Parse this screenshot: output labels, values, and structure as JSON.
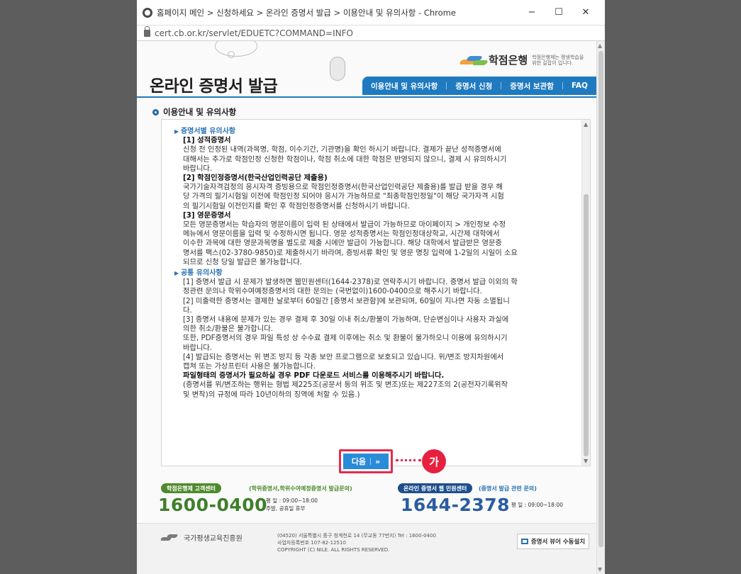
{
  "browser": {
    "title": "홈페이지 메인 > 신청하세요 > 온라인 증명서 발급 > 이용안내 및 유의사항 - Chrome",
    "url": "cert.cb.or.kr/servlet/EDUETC?COMMAND=INFO",
    "minimize": "−",
    "maximize": "☐",
    "close": "✕"
  },
  "header": {
    "bank_name": "학점은행",
    "bank_slogan": "학점은행제는 평생학습을 위한 길잡이 입니다.",
    "site_title": "온라인 증명서 발급",
    "nav": [
      "이용안내 및 유의사항",
      "증명서 신청",
      "증명서 보관함",
      "FAQ"
    ]
  },
  "section_title": "이용안내 및 유의사항",
  "content": {
    "sub1": "증명서별 유의사항",
    "items1": [
      {
        "heading": "[1] 성적증명서",
        "lines": [
          "신청 전 인정된 내역(과목명, 학점, 이수기간, 기관명)을 확인 하시기 바랍니다. 결제가 끝난 성적증명서에",
          "대해서는 추가로 학점인정 신청한 학점이나, 학점 취소에 대한 학점은 반영되지 않으니, 결제 시 유의하시기",
          "바랍니다."
        ]
      },
      {
        "heading": "[2] 학점인정증명서(한국산업인력공단 제출용)",
        "lines": [
          "국가기술자격검정의 응시자격 증빙용으로 학점인정증명서(한국산업인력공단 제출용)를 발급 받을 경우 해",
          "당 가격의 필기시험일 이전에 학점인정 되어야 응시가 가능하므로 \"최종학점인정일\"이 해당 국가자격 시험",
          "의 필기시험일 이전인지를 확인 후 학점인정증명서를 신청하시기 바랍니다."
        ]
      },
      {
        "heading": "[3] 영문증명서",
        "lines": [
          "모든 영문증명서는 학습자의 영문이름이 입력 된 상태에서 발급이 가능하므로 마이페이지 > 개인정보 수정",
          "메뉴에서 영문이름을 입력 및 수정하시면 됩니다. 영문 성적증명서는 학점인정대상학교, 시간제 대학에서",
          "이수한 과목에 대한 영문과목명을 별도로 제출 시에만 발급이 가능합니다. 해당 대학에서 발급받은 영문증",
          "명서를 팩스(02-3780-9850)로 제출하시기 바라며, 증빙서류 확인 및 영문 명칭 입력에 1-2일의 시일이 소요",
          "되므로 신청 당일 발급은 불가능합니다."
        ]
      }
    ],
    "sub2": "공통 유의사항",
    "items2": [
      "[1] 증명서 발급 시 문제가 발생하면 웹민원센터(1644-2378)로 연락주시기 바랍니다. 증명서 발급 이외의 학",
      "정관련 문의나 학위수여예정증명서의 대한 문의는 (국번없이)1600-0400으로 해주시기 바랍니다.",
      "[2] 미출력한 증명서는 결제한 날로부터 60일간 [증명서 보관함]에 보관되며, 60일이 지나면 자동 소멸됩니",
      "다.",
      "[3] 증명서 내용에 문제가 있는 경우 결제 후 30일 이내 취소/환불이 가능하며, 단순변심이나 사용자 과실에",
      "의한 취소/환불은 불가합니다.",
      "또한, PDF증명서의 경우 파일 특성 상 수수료 결제 이후에는 취소 및 환불이 불가하오니 이용에 유의하시기",
      "바랍니다.",
      "[4] 발급되는 증명서는 위 변조 방지 등 각종 보안 프로그램으로 보호되고 있습니다. 위/변조 방지차원에서",
      "캡쳐 또는 가상프린터 사용은 불가능합니다.",
      "파일형태의 증명서가 필요하실 경우 PDF 다운로드 서비스를 이용해주시기 바랍니다.",
      "(증명서를 위/변조하는 행위는 형법 제225조(공문서 등의 위조 및 변조)또는 제227조의 2(공전자기록위작",
      "및 변작)의 규정에 따라 10년이하의 징역에 처할 수 있음.)"
    ]
  },
  "next_button": {
    "label": "다음",
    "arrow": "»"
  },
  "annotation_badge": "가",
  "contacts": {
    "left_center": "학점은행제 고객센터",
    "left_note": "(학위증명서,학위수여예정증명서 발급문의)",
    "left_phone": "1600-0400",
    "left_hours1": "평  일 : 09:00~18:00",
    "left_hours2": "주말, 공휴일 휴무",
    "right_center": "온라인 증명서 웹 민원센터",
    "right_note": "(증명서 발급 관련 문의)",
    "right_phone": "1644-2378",
    "right_hours": "평  일 : 09:00~18:00"
  },
  "footer": {
    "institution": "국가평생교육진흥원",
    "address1": "(04520) 서울특별시 중구 청계천로 14 (무교동 77번지)   Tel : 1600-0400",
    "address2": "사업자등록번호 107-82-12510",
    "copyright": "COPYRIGHT (C) NILE. ALL RIGHTS RESERVED.",
    "install_button": "증명서 뷰어 수동설치"
  },
  "colors": {
    "nav_blue": "#1f7ac0",
    "accent_red": "#e22b4f",
    "green": "#4e8a2c",
    "dark_blue": "#2a5d9f"
  }
}
